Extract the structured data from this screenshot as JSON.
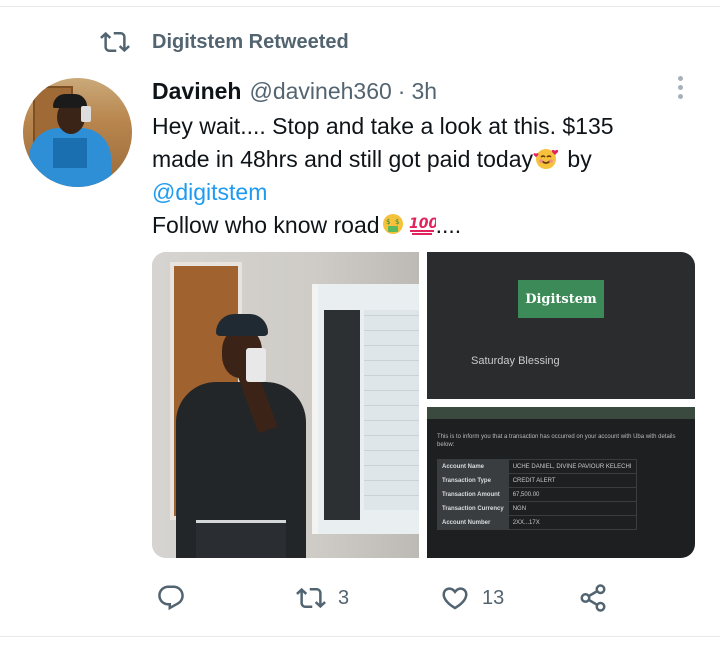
{
  "retweet": {
    "label": "Digitstem Retweeted"
  },
  "tweet": {
    "name": "Davineh",
    "handle": "@davineh360",
    "separator": "·",
    "time": "3h",
    "line1": "Hey wait.... Stop and take a look at this. $135",
    "line2": "made in 48hrs and still got paid today",
    "line2_after": " by",
    "mention": "@digitstem",
    "line4": "Follow who know road",
    "line4_after": "...."
  },
  "media": {
    "right_top": {
      "logo_text": "Digitstem",
      "caption": "Saturday Blessing"
    },
    "right_bottom": {
      "intro": "This is to inform you that a transaction has occurred on your account with Uba with details below:",
      "rows": [
        {
          "key": "Account Name",
          "value": "UCHE DANIEL, DIVINE PAVIOUR KELECHI"
        },
        {
          "key": "Transaction Type",
          "value": "CREDIT ALERT"
        },
        {
          "key": "Transaction Amount",
          "value": "67,500.00"
        },
        {
          "key": "Transaction Currency",
          "value": "NGN"
        },
        {
          "key": "Account Number",
          "value": "2XX...17X"
        }
      ]
    }
  },
  "actions": {
    "retweet_count": "3",
    "like_count": "13"
  },
  "icons": {
    "retweet": "retweet-icon",
    "reply": "reply-icon",
    "like": "heart-icon",
    "share": "share-icon",
    "more": "more-dots-icon"
  },
  "colors": {
    "accent": "#1d9bf0",
    "secondary_text": "#536471",
    "text": "#0f1419"
  }
}
